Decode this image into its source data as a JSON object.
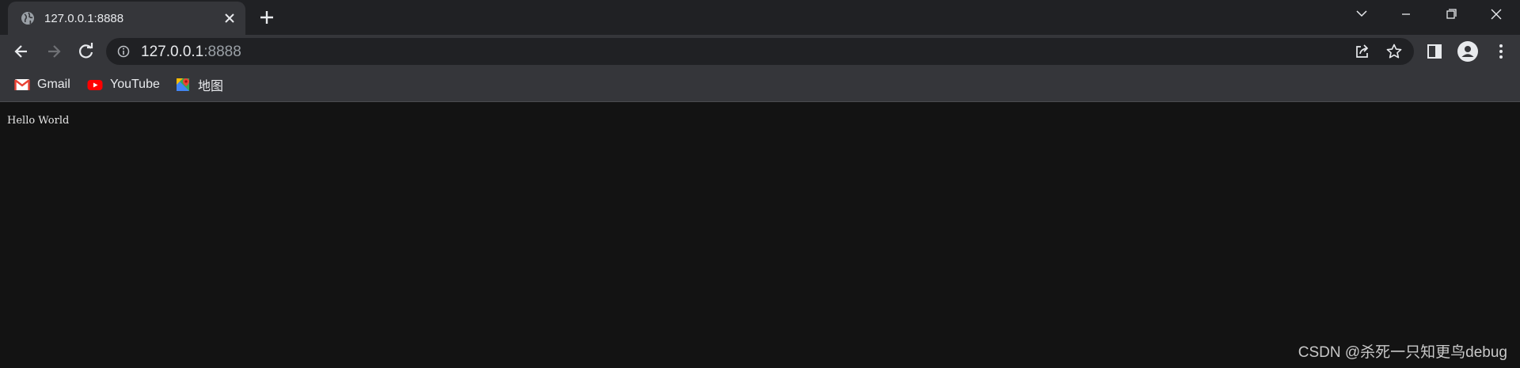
{
  "tab": {
    "title": "127.0.0.1:8888"
  },
  "address_bar": {
    "host": "127.0.0.1",
    "port": ":8888"
  },
  "bookmarks": [
    {
      "label": "Gmail",
      "icon": "gmail-icon"
    },
    {
      "label": "YouTube",
      "icon": "youtube-icon"
    },
    {
      "label": "地图",
      "icon": "maps-icon"
    }
  ],
  "page": {
    "text": "Hello World"
  },
  "watermark": "CSDN @杀死一只知更鸟debug"
}
